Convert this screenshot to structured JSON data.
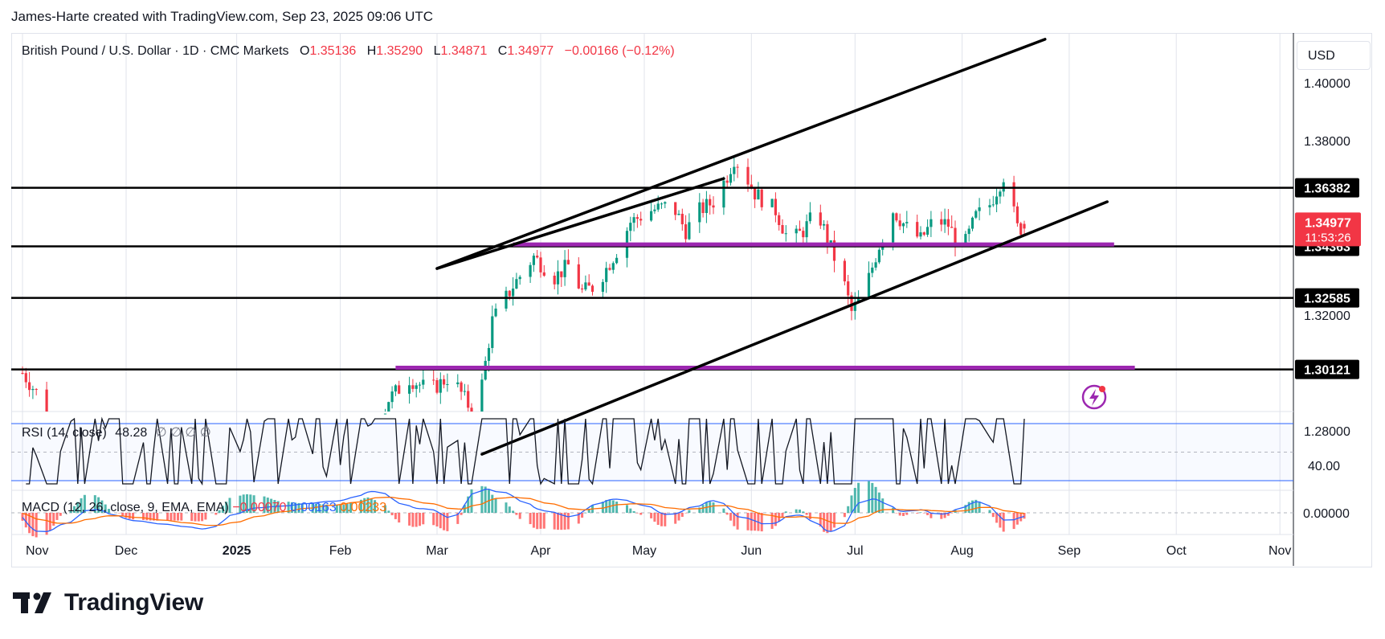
{
  "header": {
    "caption": "James-Harte created with TradingView.com, Sep 23, 2025 09:06 UTC"
  },
  "legend": {
    "symbol": "British Pound / U.S. Dollar · 1D · CMC Markets",
    "o_label": "O",
    "o_value": "1.35136",
    "h_label": "H",
    "h_value": "1.35290",
    "l_label": "L",
    "l_value": "1.34871",
    "c_label": "C",
    "c_value": "1.34977",
    "change": "−0.00166 (−0.12%)"
  },
  "currency_button": "USD",
  "rsi": {
    "label": "RSI (14, close)",
    "value": "48.28",
    "extra": "∅ ∅ ∅ ∅",
    "tick_label": "40.00"
  },
  "macd": {
    "label": "MACD (12, 26, close, 9, EMA, EMA)",
    "hist": "−0.00070",
    "macd": "0.00163",
    "signal": "0.00233",
    "tick_label": "0.00000"
  },
  "branding": {
    "name": "TradingView"
  },
  "colors": {
    "up": "#089981",
    "down": "#f23645",
    "rsi_band": "#2962ff",
    "macd_line": "#2962ff",
    "signal_line": "#ff6d00",
    "support_purple": "#9c27b0",
    "grid": "#e0e3eb"
  },
  "chart_data": {
    "type": "candlestick",
    "symbol": "GBPUSD",
    "interval": "1D",
    "x_ticks": [
      "Nov",
      "Dec",
      "2025",
      "Feb",
      "Mar",
      "Apr",
      "May",
      "Jun",
      "Jul",
      "Aug",
      "Sep",
      "Oct",
      "Nov"
    ],
    "y_ticks": [
      "1.40000",
      "1.38000",
      "1.32000",
      "1.28000"
    ],
    "ylim": [
      1.2658,
      1.4165
    ],
    "current_price": "1.34977",
    "countdown": "11:53:26",
    "horizontal_levels": [
      {
        "label": "1.36382",
        "value": 1.36382
      },
      {
        "label": "1.34363",
        "value": 1.34363
      },
      {
        "label": "1.32585",
        "value": 1.32585
      },
      {
        "label": "1.30121",
        "value": 1.30121
      }
    ],
    "anchors": [
      [
        0,
        1.3
      ],
      [
        6,
        1.29
      ],
      [
        10,
        1.27
      ],
      [
        20,
        1.265
      ],
      [
        26,
        1.278
      ],
      [
        33,
        1.268
      ],
      [
        40,
        1.26
      ],
      [
        50,
        1.245
      ],
      [
        60,
        1.225
      ],
      [
        70,
        1.235
      ],
      [
        82,
        1.245
      ],
      [
        90,
        1.255
      ],
      [
        100,
        1.27
      ],
      [
        106,
        1.291
      ],
      [
        112,
        1.298
      ],
      [
        118,
        1.294
      ],
      [
        124,
        1.299
      ],
      [
        130,
        1.287
      ],
      [
        132,
        1.289
      ],
      [
        136,
        1.318
      ],
      [
        142,
        1.33
      ],
      [
        148,
        1.34
      ],
      [
        154,
        1.333
      ],
      [
        158,
        1.337
      ],
      [
        162,
        1.328
      ],
      [
        166,
        1.33
      ],
      [
        172,
        1.342
      ],
      [
        176,
        1.352
      ],
      [
        182,
        1.356
      ],
      [
        188,
        1.358
      ],
      [
        192,
        1.349
      ],
      [
        196,
        1.356
      ],
      [
        200,
        1.359
      ],
      [
        204,
        1.368
      ],
      [
        206,
        1.374
      ],
      [
        208,
        1.371
      ],
      [
        212,
        1.362
      ],
      [
        218,
        1.356
      ],
      [
        222,
        1.345
      ],
      [
        226,
        1.349
      ],
      [
        230,
        1.356
      ],
      [
        234,
        1.343
      ],
      [
        238,
        1.33
      ],
      [
        240,
        1.321
      ],
      [
        244,
        1.329
      ],
      [
        248,
        1.344
      ],
      [
        252,
        1.356
      ],
      [
        256,
        1.35
      ],
      [
        260,
        1.346
      ],
      [
        264,
        1.353
      ],
      [
        268,
        1.351
      ],
      [
        272,
        1.342
      ],
      [
        276,
        1.354
      ],
      [
        280,
        1.358
      ],
      [
        284,
        1.368
      ],
      [
        286,
        1.36
      ],
      [
        288,
        1.35
      ],
      [
        290,
        1.3498
      ]
    ],
    "trend_lines": [
      {
        "name": "channel-top",
        "from": [
          120,
          1.336
        ],
        "to": [
          296,
          1.415
        ]
      },
      {
        "name": "channel-bottom",
        "from": [
          133,
          1.272
        ],
        "to": [
          314,
          1.359
        ]
      },
      {
        "name": "channel-upper-inner",
        "from": [
          120,
          1.336
        ],
        "to": [
          203,
          1.367
        ]
      }
    ],
    "support_zones": [
      {
        "from": 142,
        "to": 316,
        "value": 1.3443
      },
      {
        "from": 108,
        "to": 322,
        "value": 1.3018
      }
    ]
  }
}
